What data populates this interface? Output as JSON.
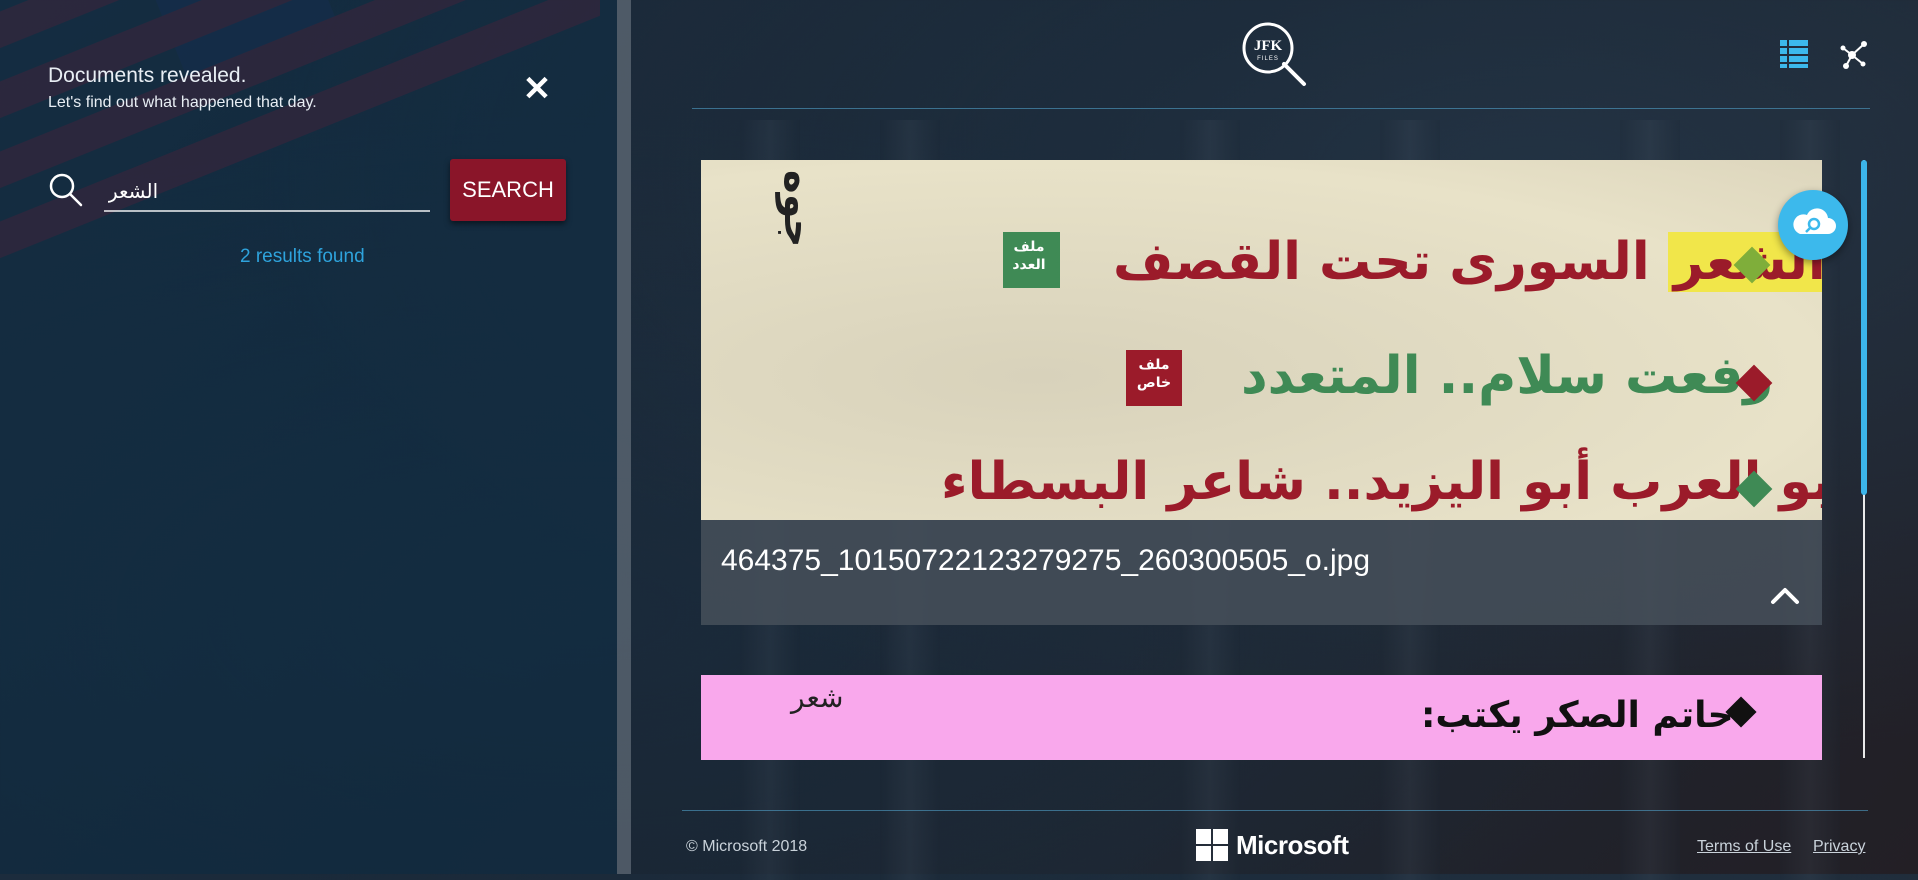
{
  "sidebar": {
    "hint_title": "Documents revealed.",
    "hint_subtitle": "Let's find out what happened that day.",
    "close_label": "✕",
    "search": {
      "value": "الشعر",
      "button_label": "SEARCH"
    },
    "results_count": "2 results found"
  },
  "header": {
    "logo_text": "JFK",
    "logo_subtext": "FILES"
  },
  "results": [
    {
      "file_name": "464375_10150722123279275_260300505_o.jpg",
      "image_text": {
        "vertical_label": "جوه",
        "badge1": [
          "ملف",
          "العدد"
        ],
        "line1_highlight": "الشعر",
        "line1_rest": "السورى تحت القصف",
        "badge2": [
          "ملف",
          "خاص"
        ],
        "line2": "رفعت سلام.. المتعدد",
        "line3": "أبو العرب أبو اليزيد.. شاعر البسطاء"
      }
    },
    {
      "file_name": "",
      "image_text": {
        "line1": "حاتم الصكر يكتب:",
        "signature": "شعر"
      }
    }
  ],
  "footer": {
    "copyright": "© Microsoft 2018",
    "brand": "Microsoft",
    "terms": "Terms of Use",
    "privacy": "Privacy"
  },
  "colors": {
    "accent": "#3cb9ec",
    "search_button": "#8a1529",
    "results_text": "#2ea3dc",
    "highlight": "#f1e64a",
    "arabic_red": "#9b1b2a",
    "arabic_green": "#3f8a55",
    "diamond_green": "#7fae3a",
    "pink_doc": "#f9a8ec"
  }
}
